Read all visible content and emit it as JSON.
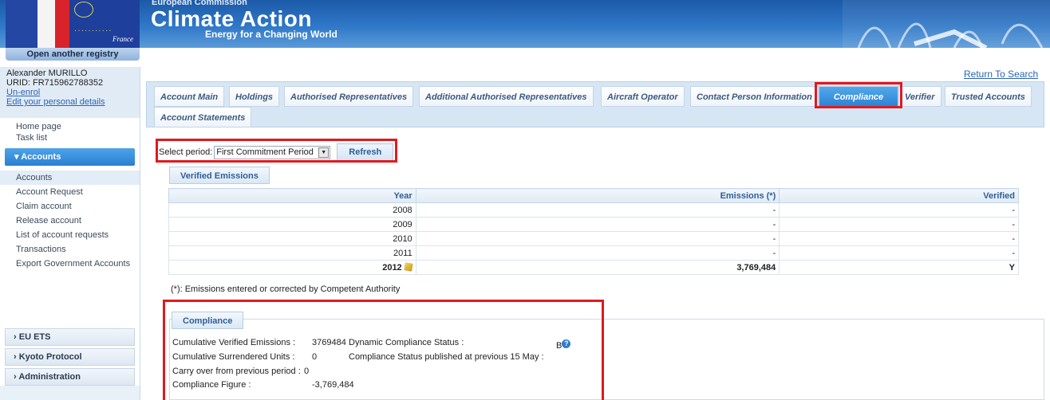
{
  "header": {
    "org": "European Commission",
    "title": "Climate Action",
    "subtitle": "Energy for a Changing World",
    "country": "France",
    "open_registry": "Open another registry"
  },
  "user": {
    "name": "Alexander MURILLO",
    "urid": "URID: FR715962788352",
    "unenrol": "Un-enrol",
    "edit_details": "Edit your personal details"
  },
  "nav": {
    "top_links": [
      "Home page",
      "Task list"
    ],
    "accounts_header": "Accounts",
    "account_links": [
      "Accounts",
      "Account Request",
      "Claim account",
      "Release account",
      "List of account requests",
      "Transactions",
      "Export Government Accounts"
    ],
    "sections": [
      "EU ETS",
      "Kyoto Protocol",
      "Administration"
    ]
  },
  "return_to_search": "Return To Search",
  "tabs": [
    "Account Main",
    "Holdings",
    "Authorised Representatives",
    "Additional Authorised Representatives",
    "Aircraft Operator",
    "Contact Person Information",
    "Compliance",
    "Verifier",
    "Trusted Accounts",
    "Account Statements"
  ],
  "active_tab": "Compliance",
  "period": {
    "label": "Select period:",
    "selected": "First Commitment Period",
    "refresh": "Refresh"
  },
  "verified_emissions": {
    "title": "Verified Emissions",
    "columns": [
      "Year",
      "Emissions (*)",
      "Verified"
    ],
    "rows": [
      [
        "2008",
        "-",
        "-"
      ],
      [
        "2009",
        "-",
        "-"
      ],
      [
        "2010",
        "-",
        "-"
      ],
      [
        "2011",
        "-",
        "-"
      ],
      [
        "2012",
        "3,769,484",
        "Y"
      ]
    ],
    "footnote": "(*): Emissions entered or corrected by Competent Authority"
  },
  "compliance": {
    "title": "Compliance",
    "cve_label": "Cumulative Verified Emissions :",
    "cve_value": "3769484",
    "csu_label": "Cumulative Surrendered Units :",
    "csu_value": "0",
    "carry_label": "Carry over from previous period :",
    "carry_value": "0",
    "figure_label": "Compliance Figure :",
    "figure_value": "-3,769,484",
    "dyn_label": "Dynamic Compliance Status :",
    "dyn_value": "B",
    "published_label": "Compliance Status published at previous 15 May :"
  },
  "colors": {
    "accent": "#2d83d4",
    "highlight": "#e0191f"
  }
}
